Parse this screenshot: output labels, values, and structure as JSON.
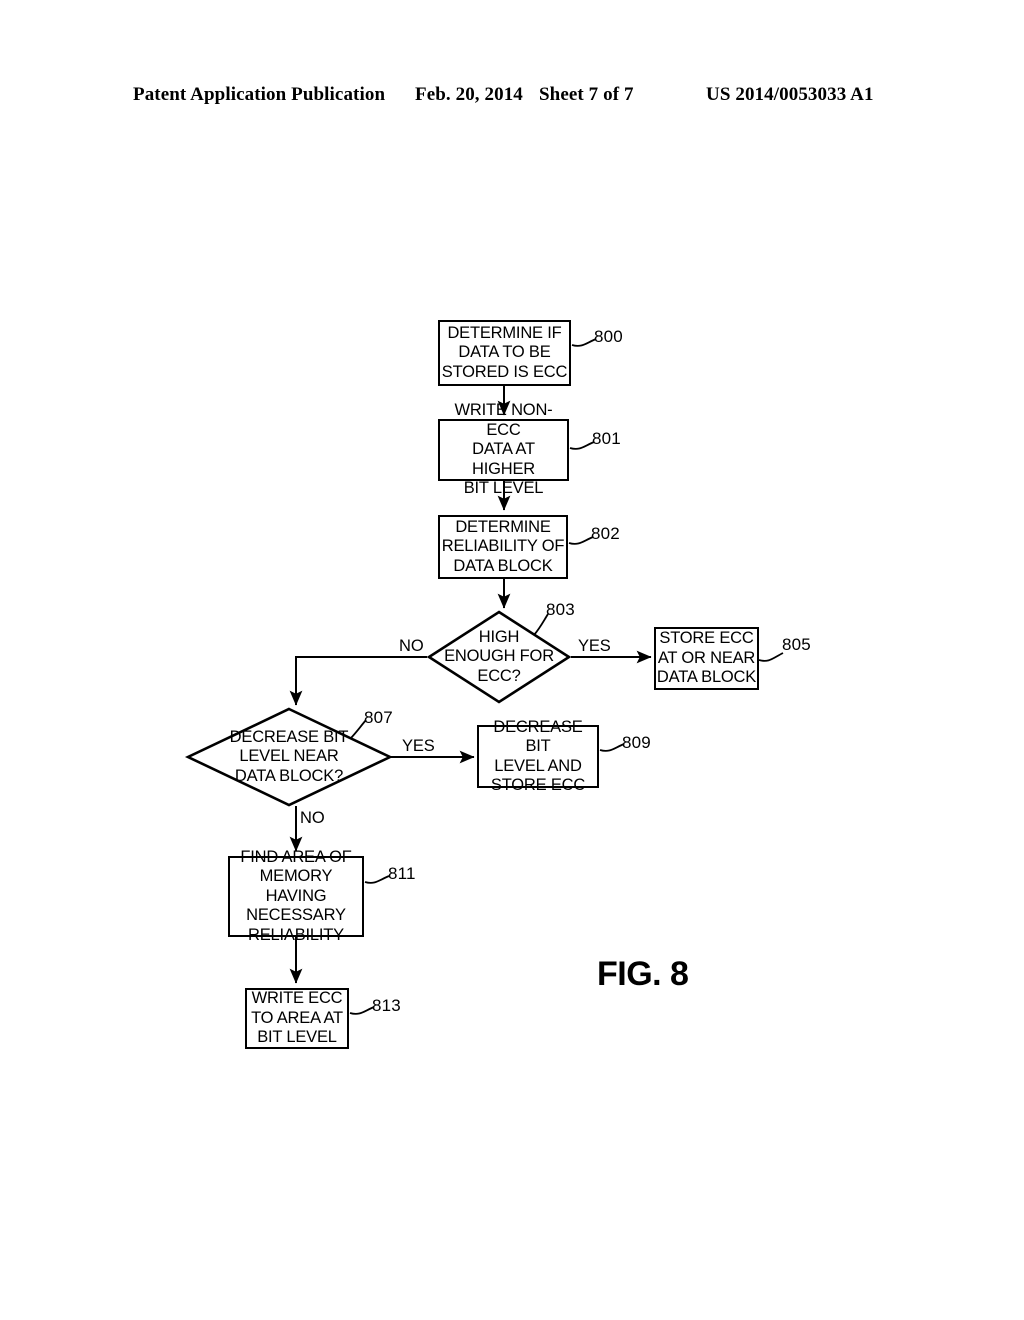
{
  "header": {
    "publication": "Patent Application Publication",
    "date": "Feb. 20, 2014",
    "sheet": "Sheet 7 of 7",
    "patent_number": "US 2014/0053033 A1"
  },
  "figure": {
    "caption": "FIG. 8"
  },
  "flowchart": {
    "nodes": [
      {
        "id": "800",
        "type": "process",
        "text": "DETERMINE IF\nDATA TO BE\nSTORED IS ECC",
        "ref": "800"
      },
      {
        "id": "801",
        "type": "process",
        "text": "WRITE NON-ECC\nDATA AT HIGHER\nBIT LEVEL",
        "ref": "801"
      },
      {
        "id": "802",
        "type": "process",
        "text": "DETERMINE\nRELIABILITY OF\nDATA BLOCK",
        "ref": "802"
      },
      {
        "id": "803",
        "type": "decision",
        "text": "HIGH\nENOUGH FOR\nECC?",
        "ref": "803"
      },
      {
        "id": "805",
        "type": "process",
        "text": "STORE ECC\nAT OR NEAR\nDATA BLOCK",
        "ref": "805"
      },
      {
        "id": "807",
        "type": "decision",
        "text": "DECREASE BIT\nLEVEL NEAR\nDATA BLOCK?",
        "ref": "807"
      },
      {
        "id": "809",
        "type": "process",
        "text": "DECREASE BIT\nLEVEL AND\nSTORE ECC",
        "ref": "809"
      },
      {
        "id": "811",
        "type": "process",
        "text": "FIND AREA OF\nMEMORY HAVING\nNECESSARY\nRELIABILITY",
        "ref": "811"
      },
      {
        "id": "813",
        "type": "process",
        "text": "WRITE ECC\nTO AREA AT\nBIT LEVEL",
        "ref": "813"
      }
    ],
    "edge_labels": {
      "decision_803_no": "NO",
      "decision_803_yes": "YES",
      "decision_807_yes": "YES",
      "decision_807_no": "NO"
    }
  }
}
